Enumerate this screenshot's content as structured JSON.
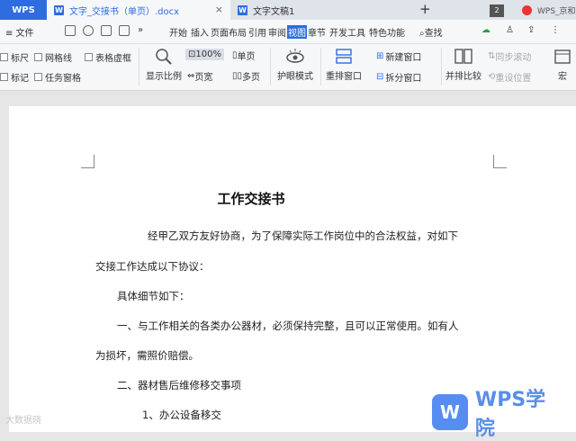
{
  "titlebar": {
    "app": "WPS",
    "tab1": "文字_交接书（单页）.docx",
    "tab2": "文字文稿1",
    "add": "+",
    "close": "×",
    "window_count": "2",
    "user": "WPS_京和"
  },
  "menubar": {
    "file": "≡ 文件",
    "more": "»",
    "tabs": [
      "开始",
      "插入",
      "页面布局",
      "引用",
      "审阅",
      "视图",
      "章节",
      "开发工具",
      "特色功能"
    ],
    "active_tab": "视图",
    "search": "查找"
  },
  "ribbon": {
    "ruler": "标尺",
    "gridlines": "网格线",
    "table_gridlines": "表格虚框",
    "marks": "标记",
    "task_pane": "任务窗格",
    "zoom": "显示比例",
    "zoom_100": "100%",
    "page_width": "页宽",
    "single_page": "单页",
    "multi_page": "多页",
    "eye_mode": "护眼模式",
    "rearrange": "重排窗口",
    "new_window": "新建窗口",
    "split_window": "拆分窗口",
    "side_by_side": "并排比较",
    "sync_scroll": "同步滚动",
    "reset_position": "重设位置",
    "macro": "宏"
  },
  "document": {
    "title": "工作交接书",
    "paragraphs": [
      "经甲乙双方友好协商，为了保障实际工作岗位中的合法权益，对如下",
      "交接工作达成以下协议：",
      "具体细节如下：",
      "一、与工作相关的各类办公器材，必须保持完整，且可以正常使用。如有人",
      "为损坏，需照价赔偿。",
      "二、器材售后维修移交事项",
      "1、办公设备移交"
    ]
  },
  "watermark": {
    "left": "大数据晓",
    "logo_mark": "W",
    "logo_text": "WPS学院"
  }
}
